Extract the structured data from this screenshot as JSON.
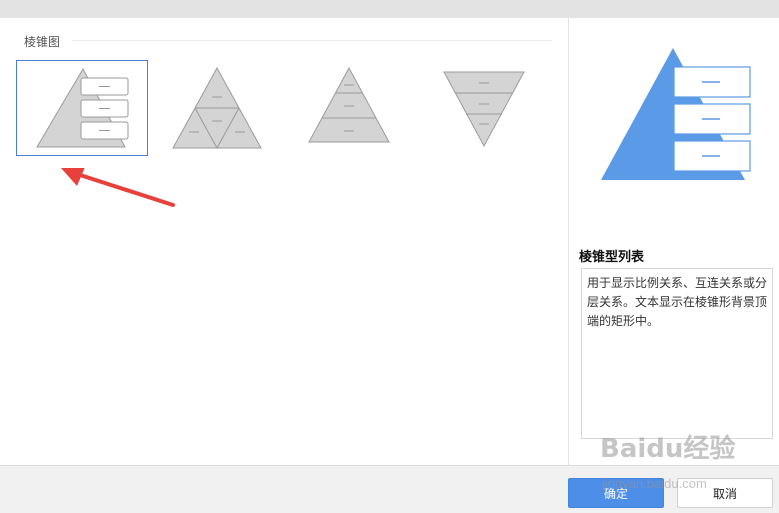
{
  "section": {
    "title": "棱锥图"
  },
  "thumbs": [
    {
      "name": "pyramid-list",
      "selected": true
    },
    {
      "name": "segmented-pyramid",
      "selected": false
    },
    {
      "name": "basic-pyramid",
      "selected": false
    },
    {
      "name": "inverted-pyramid",
      "selected": false
    }
  ],
  "preview": {
    "title": "棱锥型列表",
    "description": "用于显示比例关系、互连关系或分层关系。文本显示在棱锥形背景顶端的矩形中。",
    "accent": "#5b9ae6"
  },
  "buttons": {
    "ok": "确定",
    "cancel": "取消"
  },
  "watermark": {
    "main": "Baidu经验",
    "sub": "jingyan.baidu.com"
  },
  "colors": {
    "selection_border": "#4a7fd4",
    "arrow": "#e8403a",
    "ok_button": "#4d8ee8"
  }
}
